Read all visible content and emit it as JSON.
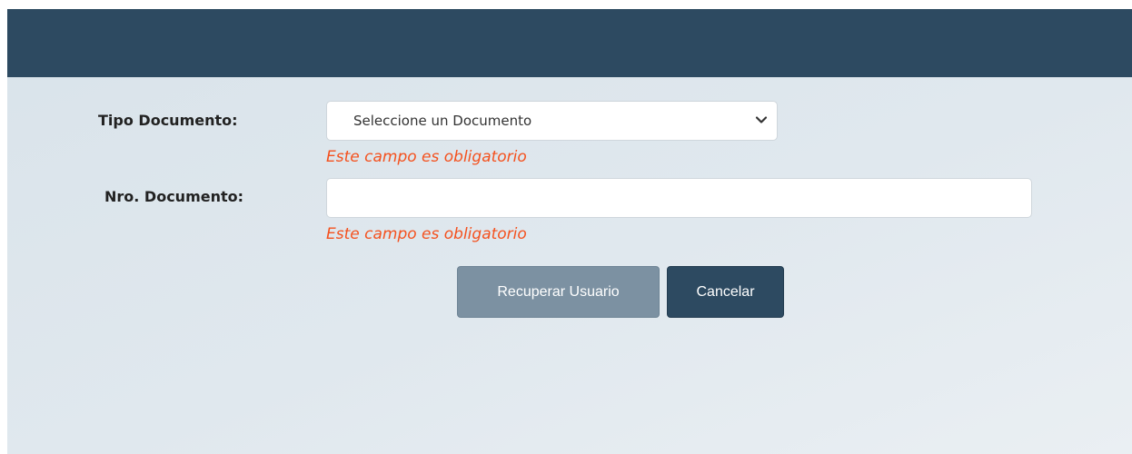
{
  "form": {
    "tipo_label": "Tipo Documento:",
    "tipo_selected": "Seleccione un Documento",
    "tipo_error": "Este campo es obligatorio",
    "nro_label": "Nro. Documento:",
    "nro_value": "",
    "nro_error": "Este campo es obligatorio"
  },
  "buttons": {
    "recover_label": "Recuperar Usuario",
    "cancel_label": "Cancelar"
  },
  "icons": {
    "select_arrow": "chevron-down-icon"
  },
  "colors": {
    "header": "#2d4a61",
    "error": "#f4511e",
    "recover_button": "#7c91a2",
    "cancel_button": "#2d4a61"
  }
}
